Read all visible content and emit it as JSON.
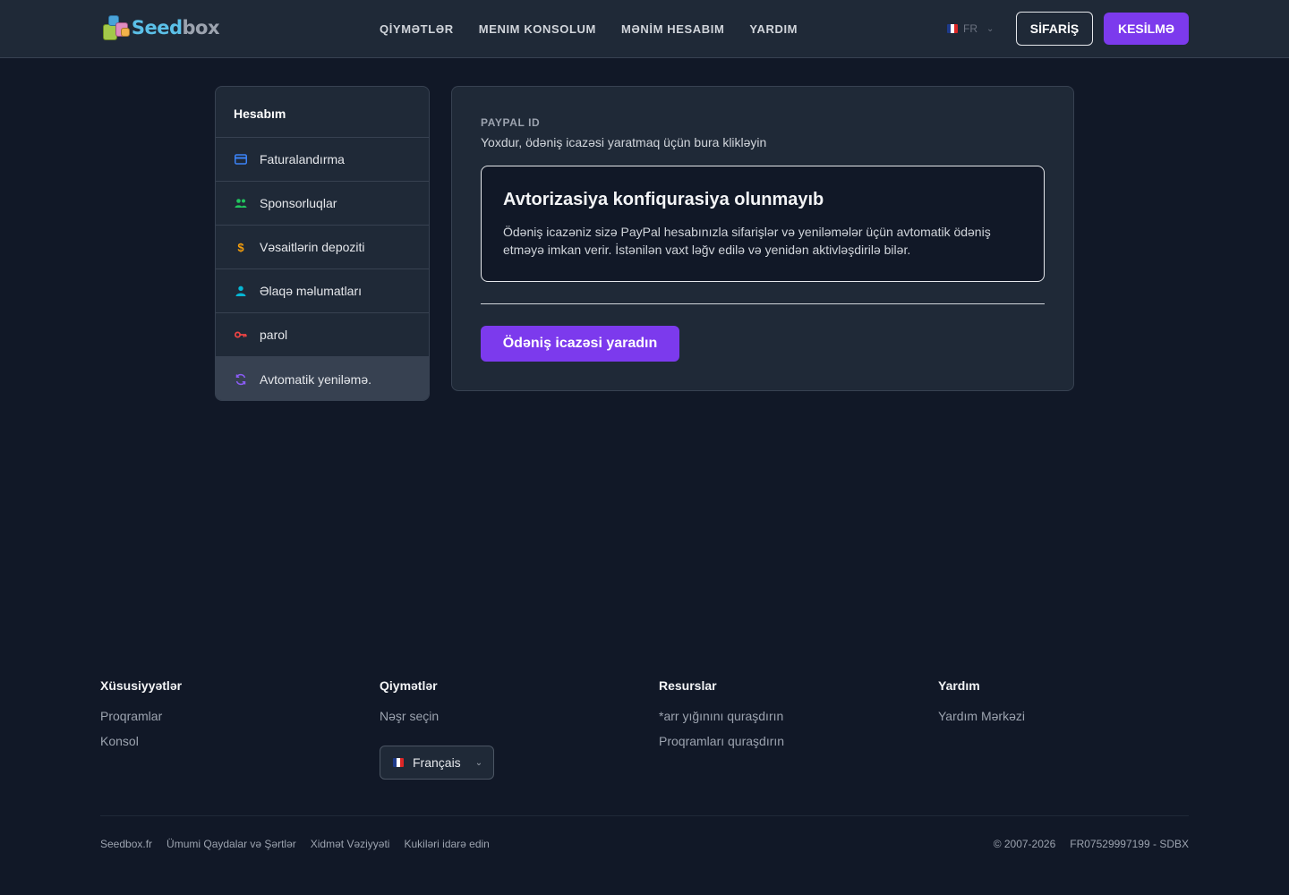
{
  "header": {
    "logo": {
      "seed": "Seed",
      "box": "box"
    },
    "nav": [
      "QİYMƏTLƏR",
      "MENIM KONSOLUM",
      "MƏNİM HESABIM",
      "YARDIM"
    ],
    "lang_code": "FR",
    "order_label": "SİFARİŞ",
    "logout_label": "KESİLMƏ"
  },
  "sidebar": {
    "title": "Hesabım",
    "items": [
      {
        "label": "Faturalandırma",
        "icon": "credit-card-icon",
        "color": "#3b82f6"
      },
      {
        "label": "Sponsorluqlar",
        "icon": "users-icon",
        "color": "#22c55e"
      },
      {
        "label": "Vəsaitlərin depoziti",
        "icon": "dollar-icon",
        "color": "#f59e0b"
      },
      {
        "label": "Əlaqə məlumatları",
        "icon": "user-icon",
        "color": "#06b6d4"
      },
      {
        "label": "parol",
        "icon": "key-icon",
        "color": "#ef4444"
      },
      {
        "label": "Avtomatik yeniləmə.",
        "icon": "refresh-icon",
        "color": "#8b5cf6",
        "active": true
      }
    ]
  },
  "main": {
    "paypal_label": "PAYPAL ID",
    "paypal_value": "Yoxdur, ödəniş icazəsi yaratmaq üçün bura klikləyin",
    "notice_title": "Avtorizasiya konfiqurasiya olunmayıb",
    "notice_text": "Ödəniş icazəniz sizə PayPal hesabınızla sifarişlər və yeniləmələr üçün avtomatik ödəniş etməyə imkan verir. İstənilən vaxt ləğv edilə və yenidən aktivləşdirilə bilər.",
    "create_button": "Ödəniş icazəsi yaradın"
  },
  "footer": {
    "col1": {
      "title": "Xüsusiyyətlər",
      "links": [
        "Proqramlar",
        "Konsol"
      ]
    },
    "col2": {
      "title": "Qiymətlər",
      "links": [
        "Nəşr seçin"
      ]
    },
    "col3": {
      "title": "Resurslar",
      "links": [
        "*arr yığınını quraşdırın",
        "Proqramları quraşdırın"
      ]
    },
    "col4": {
      "title": "Yardım",
      "links": [
        "Yardım Mərkəzi"
      ]
    },
    "language_select": "Français",
    "bottom_links": [
      "Seedbox.fr",
      "Ümumi Qaydalar və Şərtlər",
      "Xidmət Vəziyyəti",
      "Kukiləri idarə edin"
    ],
    "copyright": "© 2007-2026",
    "company_id": "FR07529997199 - SDBX"
  }
}
